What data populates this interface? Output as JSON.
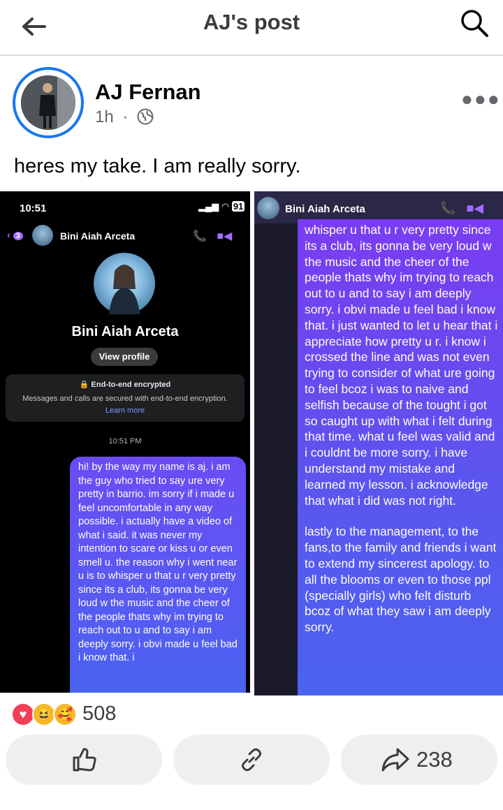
{
  "topbar": {
    "title": "AJ's post"
  },
  "post": {
    "author": "AJ Fernan",
    "time": "1h",
    "separator": "·",
    "caption": "heres my take. I am really sorry."
  },
  "shot1": {
    "clock": "10:51",
    "battery": "91",
    "unread": "3",
    "contact": "Bini Aiah Arceta",
    "profile_name": "Bini Aiah Arceta",
    "view_profile": "View profile",
    "e2e_title": "End-to-end encrypted",
    "e2e_body": "Messages and calls are secured with end-to-end encryption.",
    "learn_more": "Learn more",
    "timestamp": "10:51 PM",
    "message": "hi! by the way my name is aj. i am the guy who tried to say ure very pretty in barrio. im sorry if i made u feel uncomfortable in any way possible. i actually have a video of what i said. it was never my intention to scare or kiss u or even smell u. the reason why i went near u is to whisper u that u r very pretty since its a club, its gonna be very loud w the music and the cheer of the people thats why im trying to reach out to u and to say i am deeply sorry. i obvi made u feel bad i know that. i"
  },
  "shot2": {
    "contact": "Bini Aiah Arceta",
    "para1": "whisper u that u r very pretty since its a club, its gonna be very loud w the music and the cheer of the people thats why im trying to reach out to u and to say i am deeply sorry. i obvi made u feel bad i know that. i just wanted to let u hear that i appreciate how pretty u r. i know i crossed the line and was not even trying to consider of what ure going to feel bcoz i was to naive and selfish because of the tought i got so caught up with what i felt during that time. what u feel was valid and i couldnt be more sorry. i have understand my mistake and learned my lesson. i acknowledge that what i did was not right.",
    "para2": "lastly to the management, to the fans,to the family and friends i want to extend my sincerest apology. to all the blooms or even to those ppl (specially girls) who felt disturb bcoz of what they saw i am deeply sorry."
  },
  "reactions": {
    "count": "508",
    "icons": [
      "love-reaction",
      "haha-reaction",
      "care-reaction"
    ]
  },
  "actions": {
    "share_count": "238"
  },
  "colors": {
    "accent": "#1877f2",
    "messenger_purple": "#7a3cf2",
    "bubble_blue": "#4a63f0"
  }
}
